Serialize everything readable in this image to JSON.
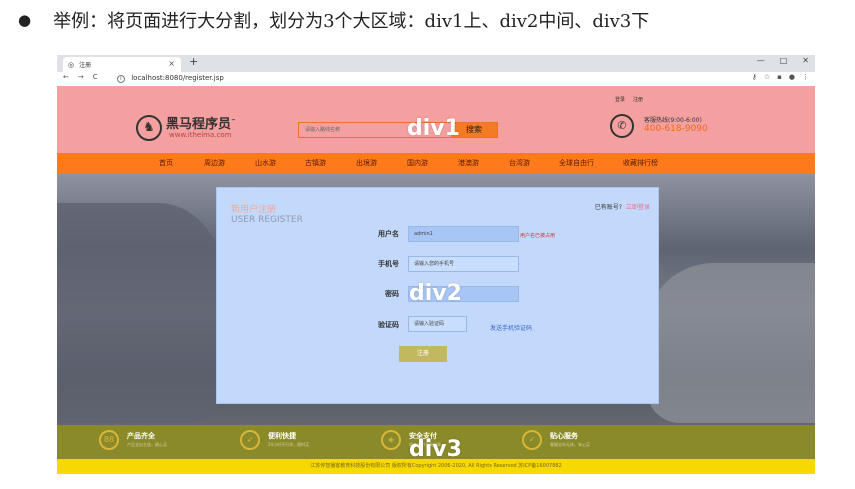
{
  "caption": {
    "bullet": "●",
    "text": "举例：将页面进行大分割，划分为3个大区域：div1上、div2中间、div3下"
  },
  "browser": {
    "tab_title": "注册",
    "tab_close": "×",
    "new_tab": "+",
    "minimize": "—",
    "maximize": "□",
    "close": "✕",
    "back": "←",
    "forward": "→",
    "reload": "C",
    "info": "i",
    "url": "localhost:8080/register.jsp"
  },
  "header": {
    "login_link": "登录",
    "register_link": "注册",
    "logo_name": "黑马程序员",
    "logo_tm": "™",
    "logo_url": "www.itheima.com",
    "search_placeholder": "请输入路线名称",
    "search_button": "搜索",
    "hotline_label": "客服热线(9:00-6:00)",
    "hotline_number": "400-618-9090",
    "region_label": "div1"
  },
  "nav": {
    "items": [
      "首页",
      "周边游",
      "山水游",
      "古镇游",
      "出境游",
      "国内游",
      "港澳游",
      "台湾游",
      "全球自由行",
      "收藏排行榜"
    ]
  },
  "form": {
    "title_cn": "新用户注册",
    "title_en": "USER REGISTER",
    "have_account": "已有账号?",
    "login_now": "立即登录",
    "username_label": "用户名",
    "username_value": "admin1",
    "username_error": "用户名已被占用",
    "phone_label": "手机号",
    "phone_placeholder": "请输入您的手机号",
    "password_label": "密码",
    "code_label": "验证码",
    "code_placeholder": "请输入验证码",
    "send_code": "发送手机验证码",
    "register_button": "注册",
    "region_label": "div2"
  },
  "footer": {
    "features": [
      {
        "title": "产品齐全",
        "desc": "产品全自主选，随心买"
      },
      {
        "title": "便利快捷",
        "desc": "24小时不打烊，随时买"
      },
      {
        "title": "安全支付",
        "desc": "知名支付工具保障"
      },
      {
        "title": "贴心服务",
        "desc": "客服全年无休，安心买"
      }
    ],
    "copyright": "江苏传智播客教育科技股份有限公司 版权所有Copyright 2006-2020, All Rights Reserved 苏ICP备16007882",
    "region_label": "div3"
  },
  "colors": {
    "div1_bg": "#f5a0a0",
    "menu_bg": "#ff7a1a",
    "form_bg": "#c3d9fb",
    "div3_bg": "#8a8a2a",
    "copyright_bg": "#f5d900"
  }
}
